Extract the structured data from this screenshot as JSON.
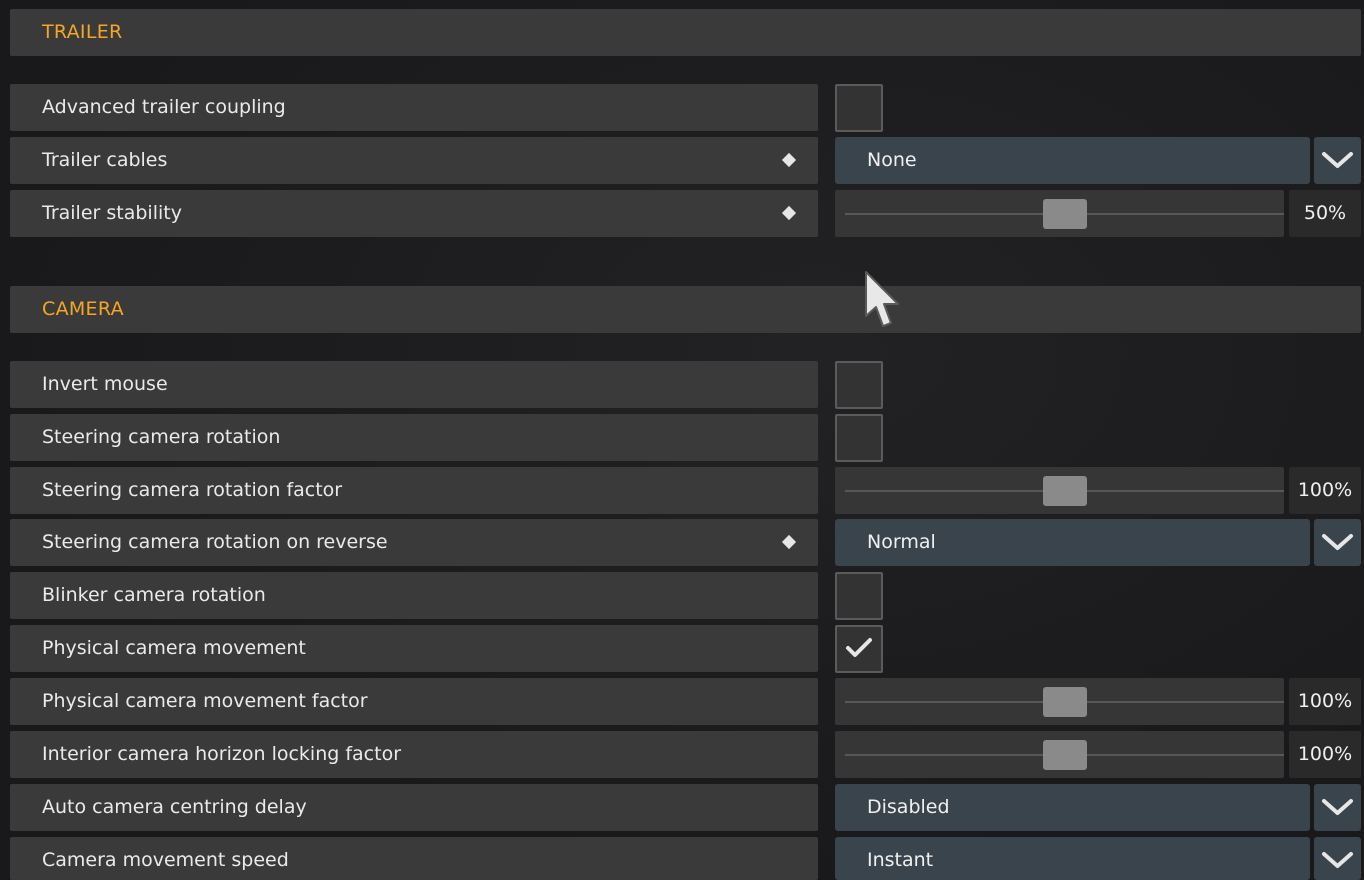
{
  "sections": {
    "trailer": "TRAILER",
    "camera": "CAMERA"
  },
  "rows": {
    "advanced_trailer_coupling": {
      "label": "Advanced trailer coupling",
      "checked": false
    },
    "trailer_cables": {
      "label": "Trailer cables",
      "value": "None"
    },
    "trailer_stability": {
      "label": "Trailer stability",
      "value": "50%",
      "level": 0.5
    },
    "invert_mouse": {
      "label": "Invert mouse",
      "checked": false
    },
    "steering_camera_rotation": {
      "label": "Steering camera rotation",
      "checked": false
    },
    "steering_camera_rotation_factor": {
      "label": "Steering camera rotation factor",
      "value": "100%",
      "level": 0.5
    },
    "steering_camera_rotation_on_reverse": {
      "label": "Steering camera rotation on reverse",
      "value": "Normal"
    },
    "blinker_camera_rotation": {
      "label": "Blinker camera rotation",
      "checked": false
    },
    "physical_camera_movement": {
      "label": "Physical camera movement",
      "checked": true
    },
    "physical_camera_movement_factor": {
      "label": "Physical camera movement factor",
      "value": "100%",
      "level": 0.5
    },
    "interior_camera_horizon_locking_factor": {
      "label": "Interior camera horizon locking factor",
      "value": "100%",
      "level": 0.5
    },
    "auto_camera_centring_delay": {
      "label": "Auto camera centring delay",
      "value": "Disabled"
    },
    "camera_movement_speed": {
      "label": "Camera movement speed",
      "value": "Instant"
    }
  },
  "colors": {
    "section_title": "#f5a623",
    "row_background": "#3a3a3a",
    "dropdown_background": "#3a444d"
  },
  "icons": {
    "modified_marker": "diamond-icon",
    "dropdown": "chevron-down-icon",
    "check": "check-icon",
    "cursor": "mouse-cursor-icon"
  }
}
